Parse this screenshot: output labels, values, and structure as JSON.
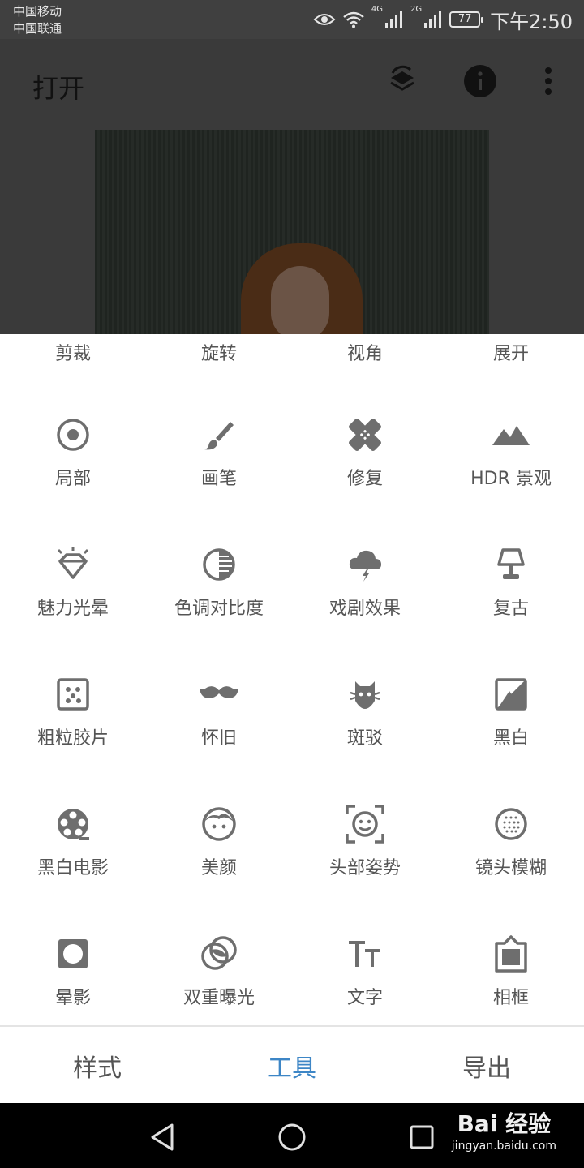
{
  "status_bar": {
    "carrier_1": "中国移动",
    "carrier_2": "中国联通",
    "network_1": "4G",
    "network_2": "2G",
    "battery": "77",
    "time": "下午2:50"
  },
  "app_bar": {
    "title": "打开"
  },
  "tools_top_row": [
    "剪裁",
    "旋转",
    "视角",
    "展开"
  ],
  "tools": [
    {
      "label": "局部",
      "icon": "selective-icon"
    },
    {
      "label": "画笔",
      "icon": "brush-icon"
    },
    {
      "label": "修复",
      "icon": "healing-icon"
    },
    {
      "label": "HDR 景观",
      "icon": "hdr-landscape-icon"
    },
    {
      "label": "魅力光晕",
      "icon": "glamour-glow-icon"
    },
    {
      "label": "色调对比度",
      "icon": "tonal-contrast-icon"
    },
    {
      "label": "戏剧效果",
      "icon": "drama-icon"
    },
    {
      "label": "复古",
      "icon": "vintage-icon"
    },
    {
      "label": "粗粒胶片",
      "icon": "grainy-film-icon"
    },
    {
      "label": "怀旧",
      "icon": "retrolux-icon"
    },
    {
      "label": "斑驳",
      "icon": "grunge-icon"
    },
    {
      "label": "黑白",
      "icon": "black-white-icon"
    },
    {
      "label": "黑白电影",
      "icon": "noir-icon"
    },
    {
      "label": "美颜",
      "icon": "portrait-icon"
    },
    {
      "label": "头部姿势",
      "icon": "head-pose-icon"
    },
    {
      "label": "镜头模糊",
      "icon": "lens-blur-icon"
    },
    {
      "label": "晕影",
      "icon": "vignette-icon"
    },
    {
      "label": "双重曝光",
      "icon": "double-exposure-icon"
    },
    {
      "label": "文字",
      "icon": "text-icon"
    },
    {
      "label": "相框",
      "icon": "frames-icon"
    }
  ],
  "tabs": {
    "styles": "样式",
    "tools": "工具",
    "export": "导出"
  },
  "watermark": {
    "brand": "Bai 经验",
    "url": "jingyan.baidu.com"
  },
  "colors": {
    "accent": "#3d86c6",
    "icon": "#6e6e6e",
    "label": "#555555"
  }
}
